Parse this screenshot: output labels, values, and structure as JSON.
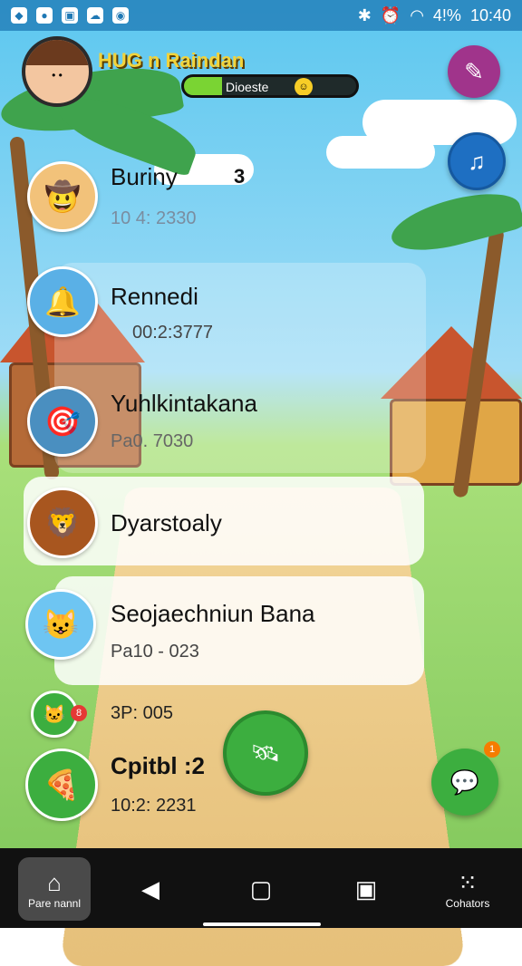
{
  "status_bar": {
    "time": "10:40",
    "battery": "4!%"
  },
  "header": {
    "username": "HUG n Raindan",
    "progress_label": "Dioeste",
    "progress_percent": 22
  },
  "list": [
    {
      "title": "Buriny",
      "subtitle": "10 4: 2330",
      "count": "3",
      "icon": "cowboy-avatar"
    },
    {
      "title": "Rennedi",
      "subtitle": "00:2:3777",
      "icon": "bell-icon"
    },
    {
      "title": "Yuhlkintakana",
      "subtitle": "Pa0. 7030",
      "icon": "target-icon"
    },
    {
      "title": "Dyarstoaly",
      "subtitle": "",
      "icon": "lion-avatar"
    },
    {
      "title": "Seojaechniun Bana",
      "subtitle": "Pa10 - 023",
      "icon": "red-hair-avatar"
    },
    {
      "title": "",
      "subtitle": "3P: 005",
      "icon": "cat-icon",
      "badge": "8"
    },
    {
      "title": "Cpitbl :2",
      "subtitle": "10:2: 2231",
      "icon": "pizza-icon"
    }
  ],
  "fabs": {
    "top_right_1": "edit-icon",
    "top_right_2": "guitar-icon",
    "center": "satellite-icon",
    "chat_badge": "1"
  },
  "bottom_nav": {
    "home_label": "Pare nannl",
    "right_label": "Cohators"
  },
  "colors": {
    "accent_green": "#3cae3f",
    "purple": "#a0348b",
    "blue": "#1e6fc2"
  }
}
